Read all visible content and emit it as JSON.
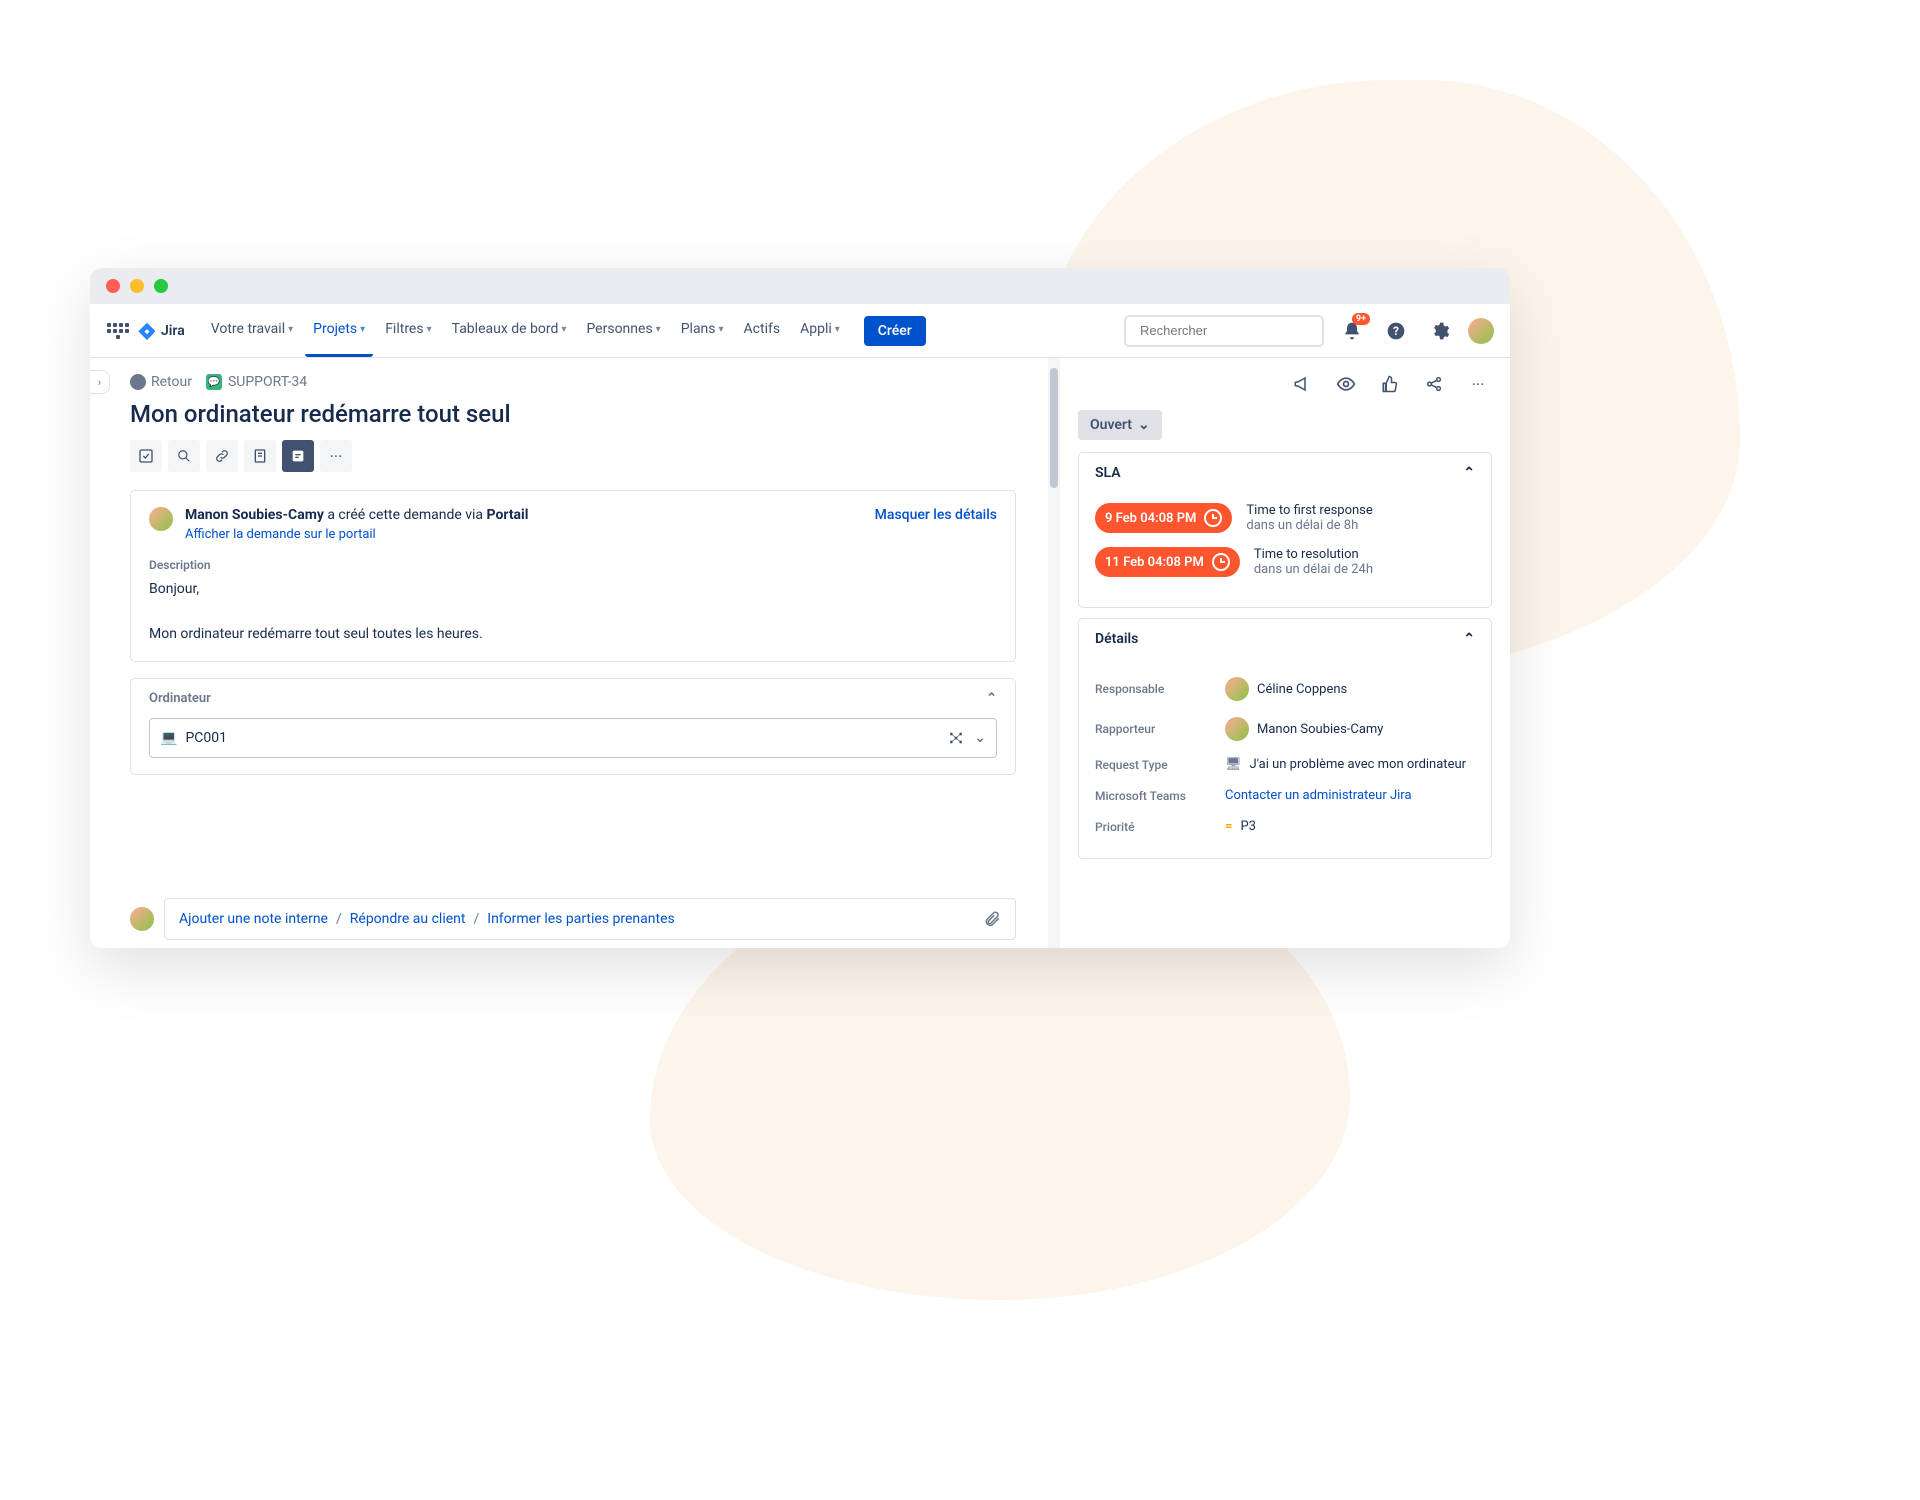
{
  "topbar": {
    "product": "Jira",
    "nav": {
      "work": "Votre travail",
      "projects": "Projets",
      "filters": "Filtres",
      "dashboards": "Tableaux de bord",
      "people": "Personnes",
      "plans": "Plans",
      "assets": "Actifs",
      "apps": "Appli"
    },
    "create": "Créer",
    "search_placeholder": "Rechercher",
    "notif_badge": "9+"
  },
  "breadcrumb": {
    "back": "Retour",
    "key": "SUPPORT-34"
  },
  "issue": {
    "title": "Mon ordinateur redémarre tout seul"
  },
  "request_panel": {
    "author": "Manon Soubies-Camy",
    "middle": " a créé cette demande via ",
    "channel": "Portail",
    "view_on_portal": "Afficher la demande sur le portail",
    "hide_details": "Masquer les détails",
    "description_label": "Description",
    "description_body": "Bonjour,\n\nMon ordinateur redémarre tout seul toutes les heures."
  },
  "asset_field": {
    "label": "Ordinateur",
    "value": "PC001"
  },
  "comment_tabs": {
    "internal": "Ajouter une note interne",
    "reply": "Répondre au client",
    "notify": "Informer les parties prenantes"
  },
  "status": "Ouvert",
  "sla": {
    "heading": "SLA",
    "items": [
      {
        "badge": "9 Feb 04:08 PM",
        "title": "Time to first response",
        "sub": "dans un délai de 8h"
      },
      {
        "badge": "11 Feb 04:08 PM",
        "title": "Time to resolution",
        "sub": "dans un délai de 24h"
      }
    ]
  },
  "details": {
    "heading": "Détails",
    "assignee_label": "Responsable",
    "assignee_value": "Céline Coppens",
    "reporter_label": "Rapporteur",
    "reporter_value": "Manon Soubies-Camy",
    "request_type_label": "Request Type",
    "request_type_value": "J'ai un problème avec mon ordinateur",
    "teams_label": "Microsoft Teams",
    "teams_value": "Contacter un administrateur Jira",
    "priority_label": "Priorité",
    "priority_value": "P3"
  }
}
